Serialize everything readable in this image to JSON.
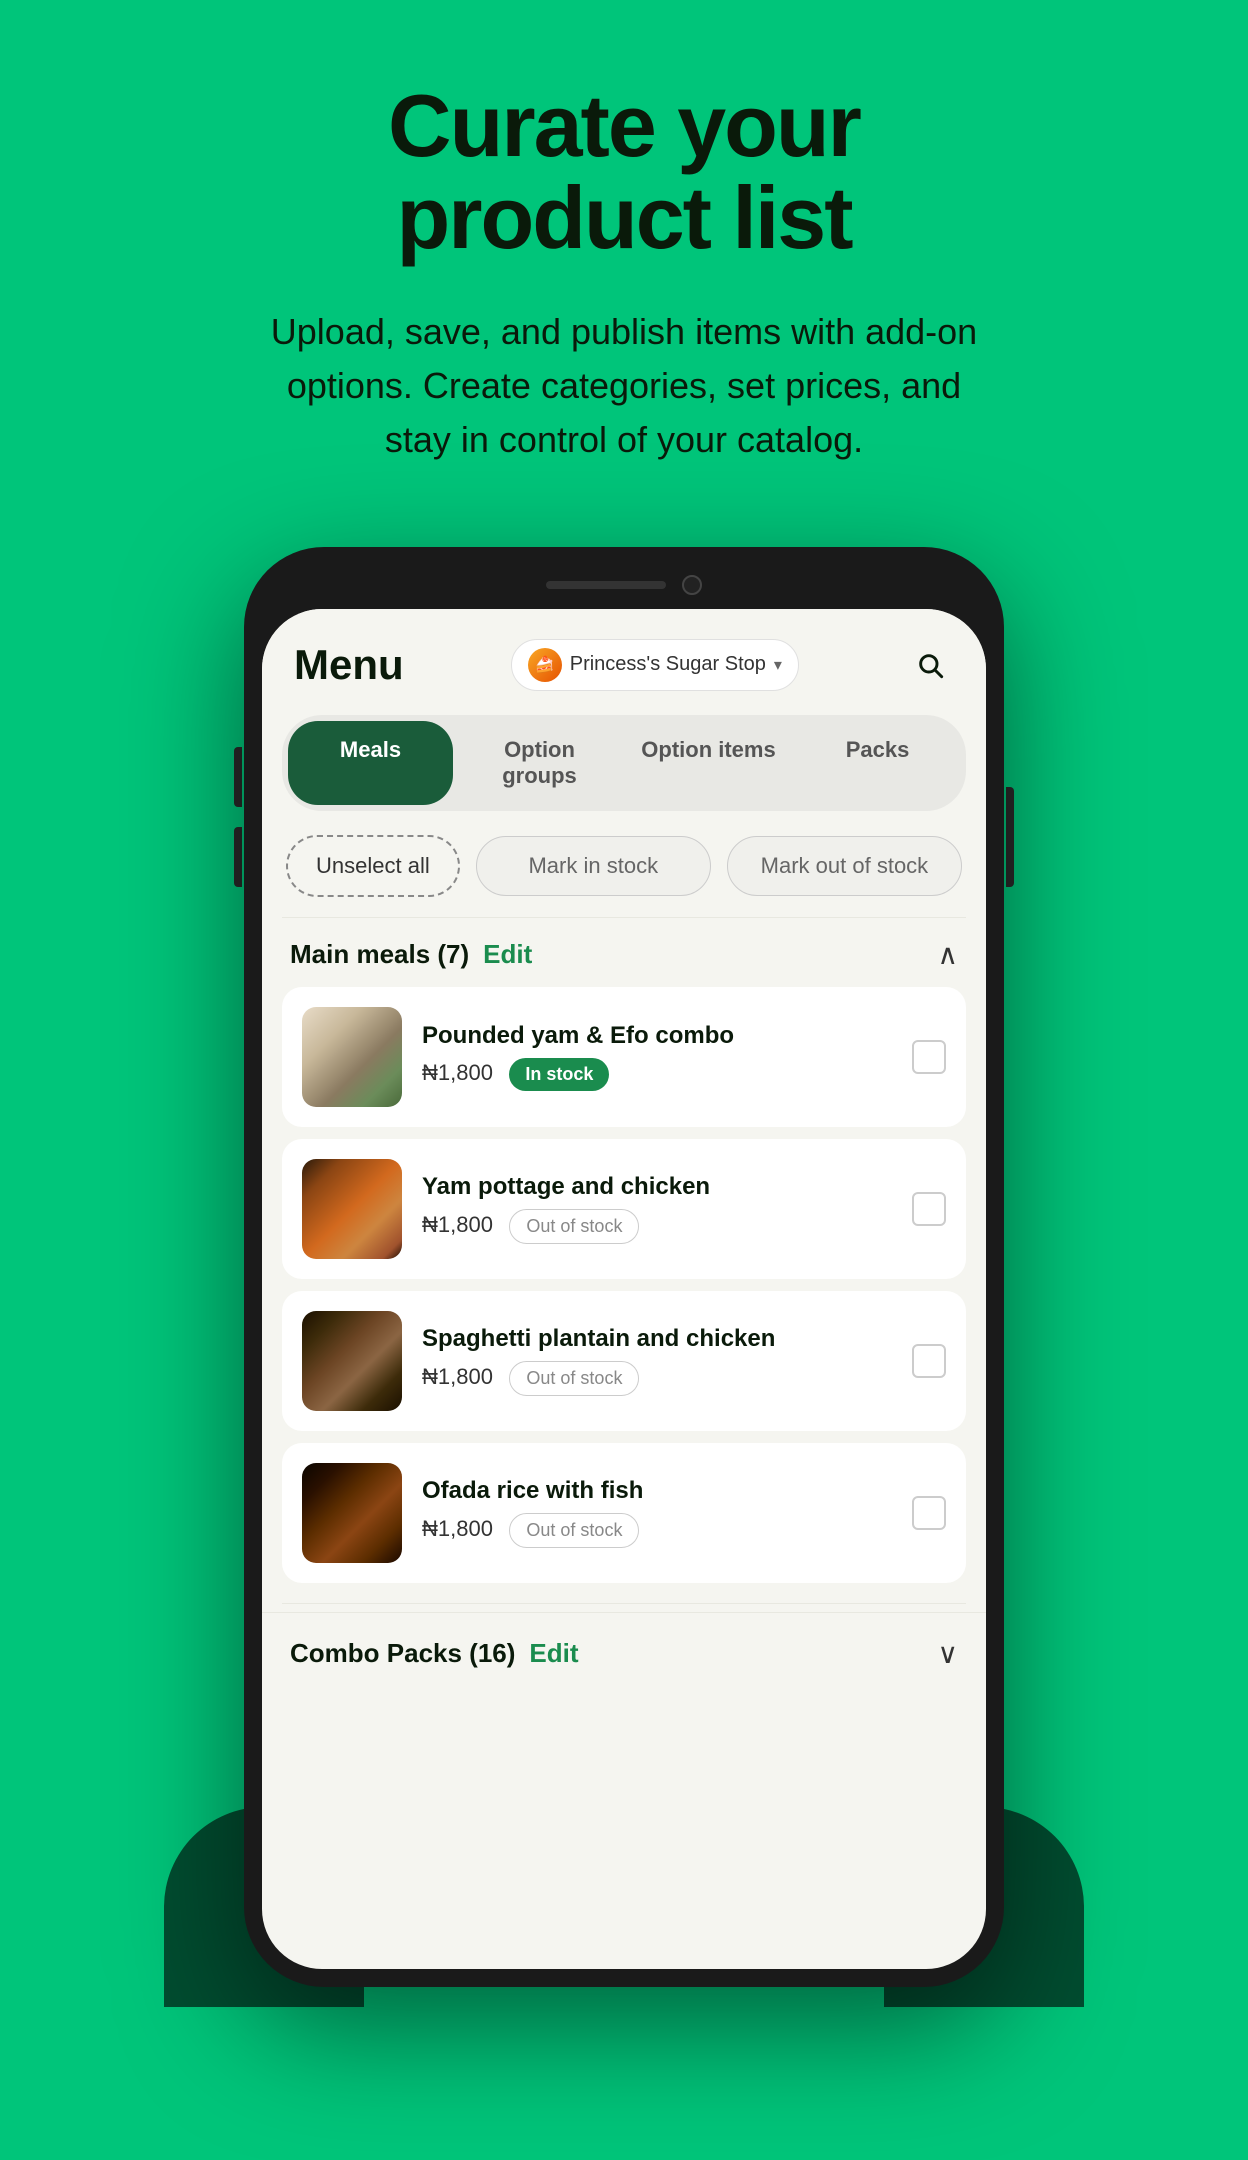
{
  "hero": {
    "title": "Curate your product list",
    "subtitle": "Upload, save, and publish items with add-on options. Create categories, set prices, and stay in control of your catalog."
  },
  "app": {
    "header": {
      "title": "Menu",
      "store_name": "Princess's Sugar Stop",
      "search_icon": "🔍"
    },
    "tabs": [
      {
        "label": "Meals",
        "active": true
      },
      {
        "label": "Option groups",
        "active": false
      },
      {
        "label": "Option items",
        "active": false
      },
      {
        "label": "Packs",
        "active": false
      }
    ],
    "stock_actions": {
      "unselect_label": "Unselect all",
      "mark_in_stock_label": "Mark in stock",
      "mark_out_stock_label": "Mark out of stock"
    },
    "main_meals_section": {
      "title": "Main meals (7)",
      "edit_label": "Edit",
      "items": [
        {
          "name": "Pounded yam & Efo combo",
          "price": "₦1,800",
          "status": "In stock",
          "status_type": "in_stock"
        },
        {
          "name": "Yam pottage and chicken",
          "price": "₦1,800",
          "status": "Out of stock",
          "status_type": "out_stock"
        },
        {
          "name": "Spaghetti plantain and chicken",
          "price": "₦1,800",
          "status": "Out of stock",
          "status_type": "out_stock"
        },
        {
          "name": "Ofada rice with fish",
          "price": "₦1,800",
          "status": "Out of stock",
          "status_type": "out_stock"
        }
      ]
    },
    "combo_section": {
      "title": "Combo Packs (16)",
      "edit_label": "Edit"
    }
  }
}
